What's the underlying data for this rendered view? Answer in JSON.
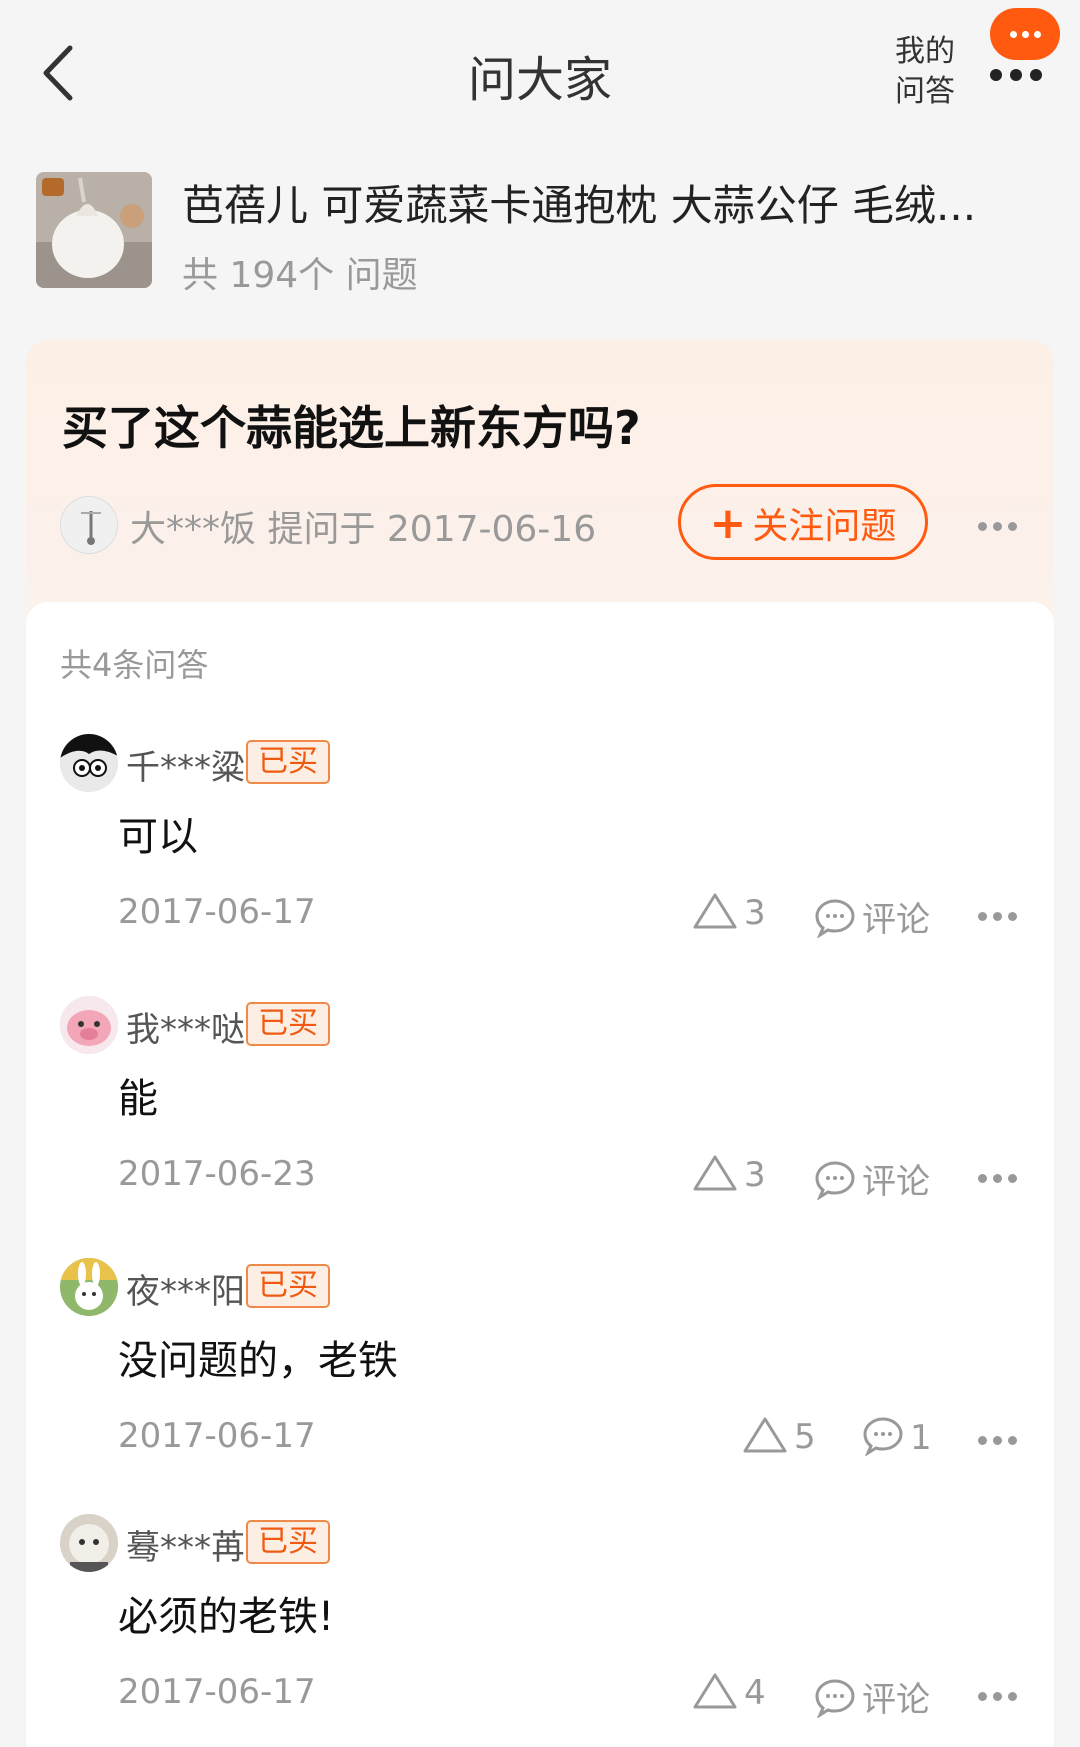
{
  "header": {
    "title": "问大家",
    "my_qa": "我的\n问答"
  },
  "product": {
    "name": "芭蓓儿 可爱蔬菜卡通抱枕 大蒜公仔 毛绒...",
    "count": "共 194个 问题"
  },
  "question": {
    "text": "买了这个蒜能选上新东方吗?",
    "asker": "大***饭 提问于 2017-06-16",
    "follow_label": "关注问题"
  },
  "answers_meta": {
    "count_label": "共4条问答"
  },
  "answers": [
    {
      "user": "千***粱",
      "badge": "已买",
      "text": "可以",
      "date": "2017-06-17",
      "likes": "3",
      "comment": "评论"
    },
    {
      "user": "我***哒",
      "badge": "已买",
      "text": "能",
      "date": "2017-06-23",
      "likes": "3",
      "comment": "评论"
    },
    {
      "user": "夜***阳",
      "badge": "已买",
      "text": "没问题的，老铁",
      "date": "2017-06-17",
      "likes": "5",
      "comment": "1"
    },
    {
      "user": "蓦***苒",
      "badge": "已买",
      "text": "必须的老铁!",
      "date": "2017-06-17",
      "likes": "4",
      "comment": "评论"
    }
  ],
  "colors": {
    "accent": "#ff5a10",
    "badge_bg": "#fdeee3",
    "question_card": "#fcefe6"
  },
  "icons": {
    "back": "chevron-left-icon",
    "message": "message-bubble-icon",
    "more": "ellipsis-icon",
    "like": "triangle-up-icon",
    "comment": "comment-bubble-icon"
  }
}
